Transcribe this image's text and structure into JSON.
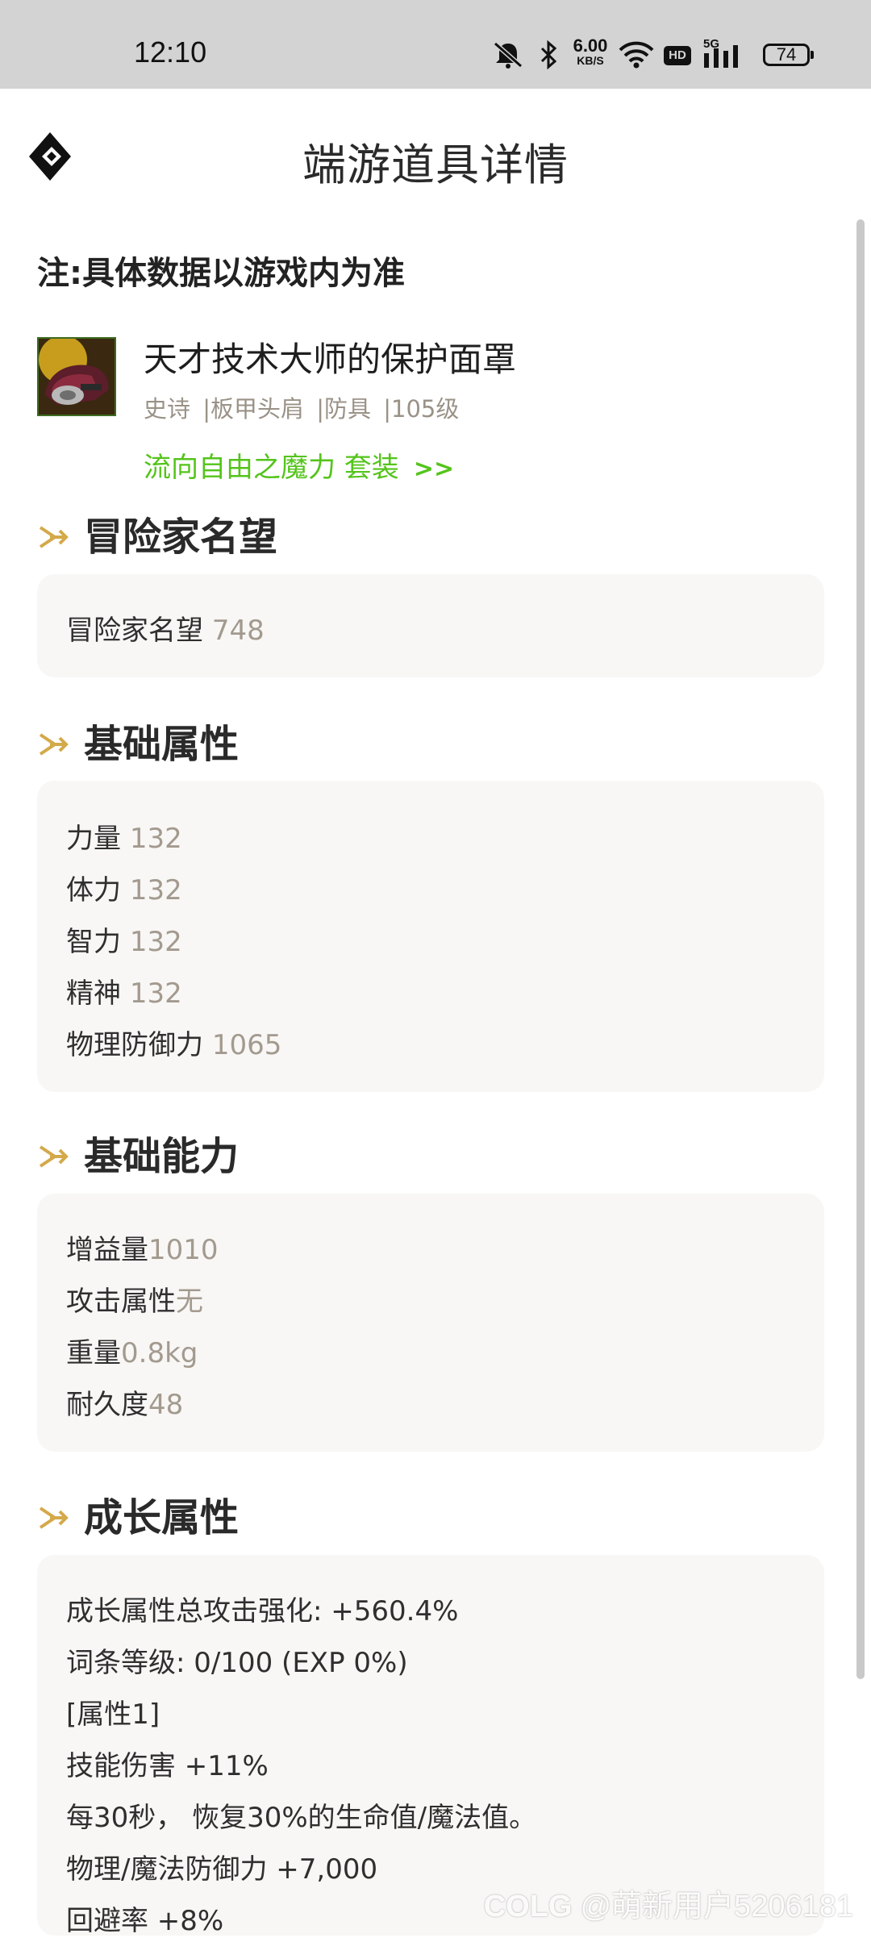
{
  "status_bar": {
    "time": "12:10",
    "speed_value": "6.00",
    "speed_unit": "KB/S",
    "network": "5G",
    "hd": "HD",
    "battery": "74"
  },
  "header": {
    "title": "端游道具详情"
  },
  "note": "注:具体数据以游戏内为准",
  "item": {
    "name": "天才技术大师的保护面罩",
    "rarity": "史诗",
    "slot": "|板甲头肩",
    "category": "|防具",
    "level": "|105级",
    "set_name": "流向自由之魔力 套装",
    "set_arrows": ">>"
  },
  "sections": {
    "fame": {
      "title": "冒险家名望",
      "rows": [
        {
          "label": "冒险家名望 ",
          "value": "748"
        }
      ]
    },
    "base_stats": {
      "title": "基础属性",
      "rows": [
        {
          "label": "力量 ",
          "value": "132"
        },
        {
          "label": "体力 ",
          "value": "132"
        },
        {
          "label": "智力 ",
          "value": "132"
        },
        {
          "label": "精神 ",
          "value": "132"
        },
        {
          "label": "物理防御力 ",
          "value": "1065"
        }
      ]
    },
    "base_ability": {
      "title": "基础能力",
      "rows": [
        {
          "label": "增益量",
          "value": "1010"
        },
        {
          "label": "攻击属性",
          "value": "无"
        },
        {
          "label": "重量",
          "value": "0.8kg"
        },
        {
          "label": "耐久度",
          "value": "48"
        }
      ]
    },
    "growth": {
      "title": "成长属性",
      "rows": [
        "成长属性总攻击强化: +560.4%",
        "词条等级: 0/100 (EXP 0%)",
        "[属性1]",
        "技能伤害 +11%",
        "每30秒， 恢复30%的生命值/魔法值。",
        "物理/魔法防御力 +7,000",
        "回避率 +8%"
      ]
    }
  },
  "watermark": {
    "brand": "COLG",
    "user": "@萌新用户5206181"
  }
}
